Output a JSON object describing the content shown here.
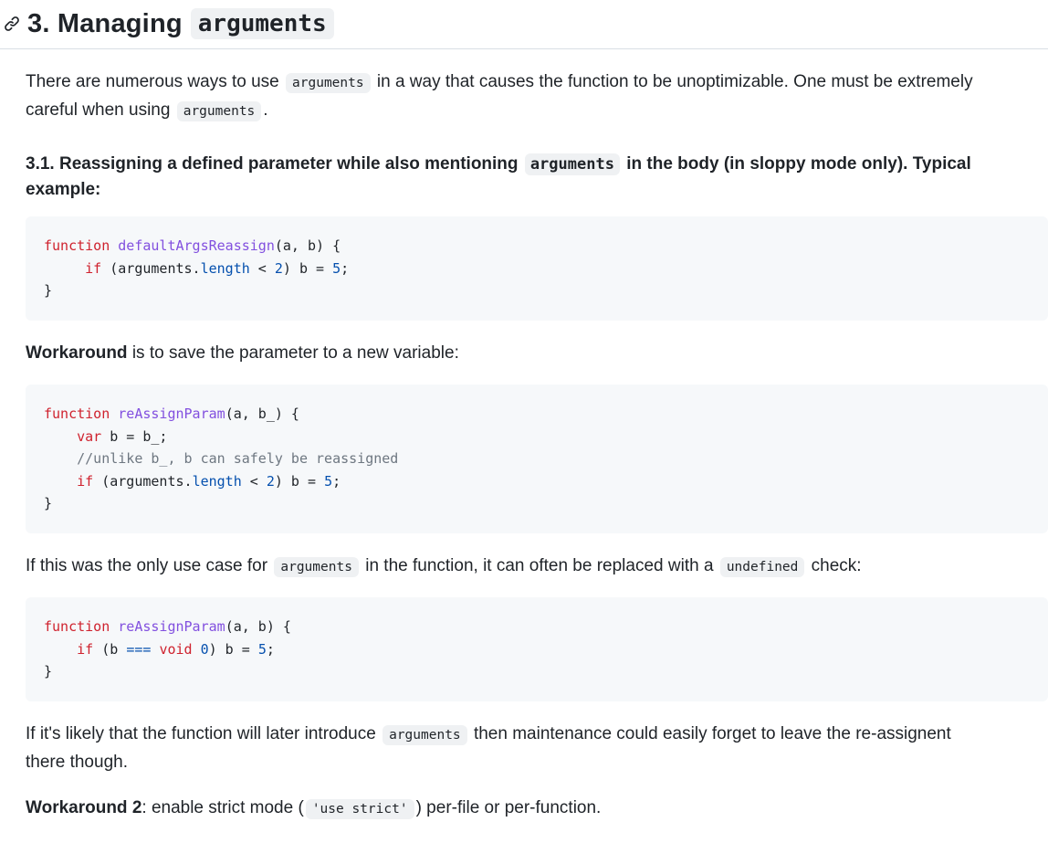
{
  "heading": {
    "number": "3. Managing",
    "code": "arguments"
  },
  "intro": {
    "t1": "There are numerous ways to use",
    "c1": "arguments",
    "t2": "in a way that causes the function to be unoptimizable. One must be extremely",
    "t3": "careful when using",
    "c2": "arguments",
    "t4": "."
  },
  "subheading": {
    "t1": "3.1. Reassigning a defined parameter while also mentioning",
    "code": "arguments",
    "t2": "in the body (in sloppy mode only). Typical",
    "t3": "example:"
  },
  "code1": {
    "l1": {
      "kw": "function",
      "fn": "defaultArgsReassign",
      "rest": "(a, b) {"
    },
    "l2": {
      "indent": "     ",
      "kw": "if",
      "a": " (arguments.",
      "prop": "length",
      "b": " < ",
      "n1": "2",
      "c": ") b = ",
      "n2": "5",
      "d": ";"
    },
    "l3": {
      "text": "}"
    }
  },
  "workaround1": {
    "bold": "Workaround",
    "rest": " is to save the parameter to a new variable:"
  },
  "code2": {
    "l1": {
      "kw": "function",
      "fn": "reAssignParam",
      "rest": "(a, b_) {"
    },
    "l2": {
      "indent": "    ",
      "kw": "var",
      "rest": " b = b_;"
    },
    "l3": {
      "indent": "    ",
      "comment": "//unlike b_, b can safely be reassigned"
    },
    "l4": {
      "indent": "    ",
      "kw": "if",
      "a": " (arguments.",
      "prop": "length",
      "b": " < ",
      "n1": "2",
      "c": ") b = ",
      "n2": "5",
      "d": ";"
    },
    "l5": {
      "text": "}"
    }
  },
  "para2": {
    "t1": "If this was the only use case for",
    "c1": "arguments",
    "t2": "in the function, it can often be replaced with a",
    "c2": "undefined",
    "t3": "check:"
  },
  "code3": {
    "l1": {
      "kw": "function",
      "fn": "reAssignParam",
      "rest": "(a, b) {"
    },
    "l2": {
      "indent": "    ",
      "kw": "if",
      "a": " (b ",
      "op": "===",
      "sp": " ",
      "kw2": "void",
      "sp2": " ",
      "n1": "0",
      "c": ") b = ",
      "n2": "5",
      "d": ";"
    },
    "l3": {
      "text": "}"
    }
  },
  "para3": {
    "t1": "If it's likely that the function will later introduce",
    "c1": "arguments",
    "t2": "then maintenance could easily forget to leave the re-assignent",
    "t3": "there though."
  },
  "workaround2": {
    "bold": "Workaround 2",
    "t1": ": enable strict mode (",
    "code": "'use strict'",
    "t2": ") per-file or per-function."
  },
  "icons": {
    "anchor": "link-icon"
  },
  "colors": {
    "keyword": "#cf222e",
    "function": "#8250df",
    "property": "#0550ae",
    "comment": "#6e7781",
    "string": "#0a3069",
    "code_bg": "#f6f8fa"
  }
}
